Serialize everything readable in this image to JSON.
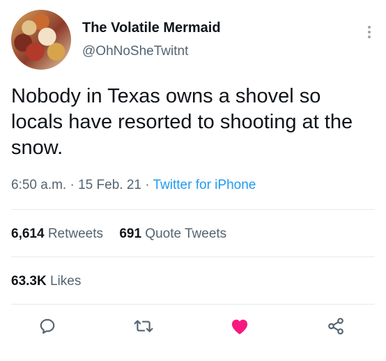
{
  "author": {
    "display_name": "The Volatile Mermaid",
    "handle": "@OhNoSheTwitnt"
  },
  "tweet": {
    "text": "Nobody in Texas owns a shovel so locals have resorted to shooting at the snow.",
    "time": "6:50 a.m.",
    "date": "15 Feb. 21",
    "source": "Twitter for iPhone",
    "separator": "·"
  },
  "stats": {
    "retweets_count": "6,614",
    "retweets_label": "Retweets",
    "quotes_count": "691",
    "quotes_label": "Quote Tweets",
    "likes_count": "63.3K",
    "likes_label": "Likes"
  },
  "actions": {
    "reply_icon": "reply-icon",
    "retweet_icon": "retweet-icon",
    "like_icon": "heart-icon",
    "share_icon": "share-icon",
    "like_color": "#f91880",
    "icon_color": "#536471"
  },
  "colors": {
    "link": "#1d9bf0",
    "secondary_text": "#536471",
    "primary_text": "#0f1419"
  }
}
